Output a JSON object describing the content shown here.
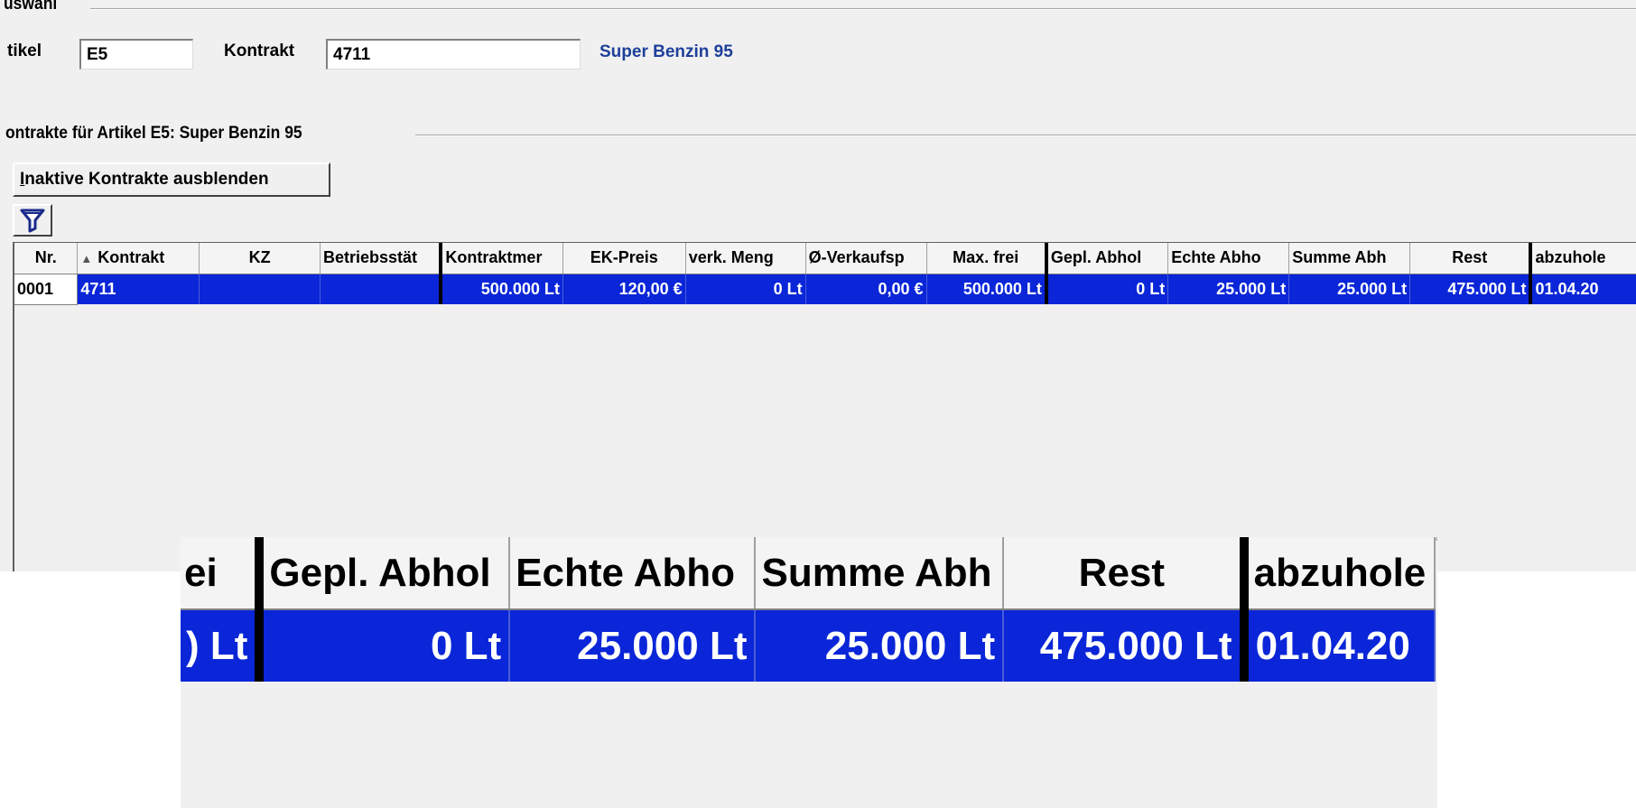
{
  "selection_frame": {
    "title": "uswahl"
  },
  "article": {
    "label": "tikel",
    "value": "E5"
  },
  "contract": {
    "label": "Kontrakt",
    "value": "4711"
  },
  "article_name": "Super Benzin 95",
  "contracts_frame": {
    "title": "ontrakte für Artikel E5: Super Benzin 95"
  },
  "hide_inactive_button": {
    "mnemonic": "I",
    "rest": "naktive Kontrakte ausblenden"
  },
  "filter_icon": "funnel-icon",
  "grid": {
    "sort_column": "Kontrakt",
    "sort_direction": "ascending",
    "columns": [
      "Nr.",
      "Kontrakt",
      "KZ",
      "Betriebsstät",
      "Kontraktmer",
      "EK-Preis",
      "verk. Meng",
      "Ø-Verkaufsp",
      "Max. frei",
      "Gepl. Abhol",
      "Echte Abho",
      "Summe Abh",
      "Rest",
      "abzuhole"
    ],
    "rows": [
      [
        "0001",
        "4711",
        "",
        "",
        "500.000 Lt",
        "120,00 €",
        "0 Lt",
        "0,00 €",
        "500.000 Lt",
        "0 Lt",
        "25.000 Lt",
        "25.000 Lt",
        "475.000 Lt",
        "01.04.20"
      ]
    ],
    "selected_row_color": "#0a26d8"
  },
  "zoom": {
    "columns": [
      "ei",
      "Gepl. Abhol",
      "Echte Abho",
      "Summe Abh",
      "Rest",
      "abzuhole"
    ],
    "row": [
      ") Lt",
      "0 Lt",
      "25.000 Lt",
      "25.000 Lt",
      "475.000 Lt",
      "01.04.20"
    ]
  }
}
